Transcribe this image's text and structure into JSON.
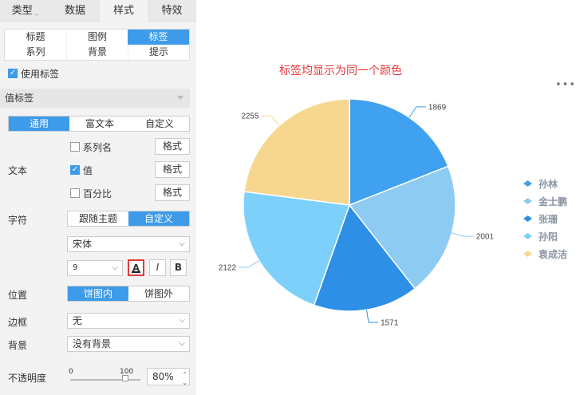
{
  "tabs": [
    "类型",
    "数据",
    "样式",
    "特效"
  ],
  "subtabs": [
    "标题",
    "图例",
    "标签",
    "系列",
    "背景",
    "提示"
  ],
  "use_label": "使用标签",
  "value_label_section": "值标签",
  "text_type_options": [
    "通用",
    "富文本",
    "自定义"
  ],
  "text_label": "文本",
  "series_name": "系列名",
  "value": "值",
  "percent": "百分比",
  "format": "格式",
  "char_label": "字符",
  "char_options": [
    "跟随主题",
    "自定义"
  ],
  "font": "宋体",
  "font_size": "9",
  "format_buttons": {
    "color": "A",
    "italic": "I",
    "bold": "B"
  },
  "position_label": "位置",
  "position_options": [
    "饼图内",
    "饼图外"
  ],
  "border_label": "边框",
  "border_value": "无",
  "background_label": "背景",
  "background_value": "没有背景",
  "opacity_label": "不透明度",
  "opacity_min": "0",
  "opacity_max": "100",
  "opacity_value": "80%",
  "chart": {
    "title": "标签均显示为同一个颜色",
    "more": "•••"
  },
  "colors": {
    "accent": "#3d9be9",
    "title_red": "#e8363a"
  },
  "chart_data": {
    "type": "pie",
    "categories": [
      "孙林",
      "金士鹏",
      "张珊",
      "孙阳",
      "袁成洁"
    ],
    "values": [
      1869,
      2001,
      1571,
      2122,
      2255
    ],
    "colors": [
      "#3fa1ef",
      "#8ecbf3",
      "#2d8fe6",
      "#7cd0fa",
      "#f7d78f"
    ],
    "title": "标签均显示为同一个颜色",
    "legend": "right"
  }
}
